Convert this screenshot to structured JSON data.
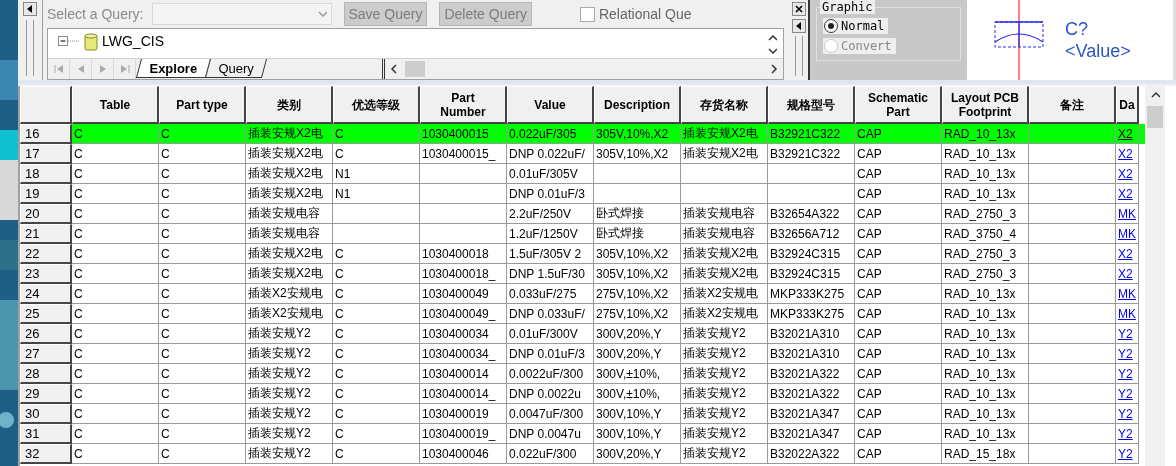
{
  "query_bar": {
    "label": "Select a Query:",
    "buttons": [
      {
        "label": "Save Query",
        "disabled": true
      },
      {
        "label": "Delete Query",
        "disabled": true
      }
    ],
    "relational": {
      "label": "Relational Que",
      "checked": false
    }
  },
  "explorer": {
    "tree": [
      {
        "label": "LWG_CIS",
        "expanded": true
      }
    ],
    "tabs": [
      {
        "label": "Explore",
        "selected": true
      },
      {
        "label": "Query",
        "selected": false
      }
    ]
  },
  "preview": {
    "group": "Graphic",
    "options": [
      {
        "label": "Normal",
        "selected": true,
        "disabled": false
      },
      {
        "label": "Convert",
        "selected": false,
        "disabled": true
      }
    ],
    "refdes": "C?",
    "value": "<Value>"
  },
  "table": {
    "columns": [
      {
        "label": "Table",
        "kind": "text"
      },
      {
        "label": "Part type",
        "kind": "text"
      },
      {
        "label": "类别",
        "kind": "text"
      },
      {
        "label": "优选等级",
        "kind": "text"
      },
      {
        "label": "Part Number",
        "kind": "text"
      },
      {
        "label": "Value",
        "kind": "text"
      },
      {
        "label": "Description",
        "kind": "text"
      },
      {
        "label": "存货名称",
        "kind": "text"
      },
      {
        "label": "规格型号",
        "kind": "text"
      },
      {
        "label": "Schematic Part",
        "kind": "text"
      },
      {
        "label": "Layout PCB Footprint",
        "kind": "text"
      },
      {
        "label": "备注",
        "kind": "text"
      },
      {
        "label": "Da",
        "kind": "link"
      }
    ],
    "rows": [
      {
        "num": "16",
        "selected": true,
        "cells": [
          "C",
          "C",
          "插装安规X2电",
          "C",
          "1030400015",
          "0.022uF/305",
          "305V,10%,X2",
          "插装安规X2电",
          "B32921C322",
          "CAP",
          "RAD_10_13x",
          null,
          "X2"
        ]
      },
      {
        "num": "17",
        "selected": false,
        "cells": [
          "C",
          "C",
          "插装安规X2电",
          "C",
          "1030400015_",
          "DNP 0.022uF/",
          "305V,10%,X2",
          "插装安规X2电",
          "B32921C322",
          "CAP",
          "RAD_10_13x",
          null,
          "X2"
        ]
      },
      {
        "num": "18",
        "selected": false,
        "cells": [
          "C",
          "C",
          "插装安规X2电",
          "N1",
          null,
          "0.01uF/305V",
          null,
          null,
          null,
          "CAP",
          "RAD_10_13x",
          null,
          "X2"
        ]
      },
      {
        "num": "19",
        "selected": false,
        "cells": [
          "C",
          "C",
          "插装安规X2电",
          "N1",
          null,
          "DNP 0.01uF/3",
          null,
          null,
          null,
          "CAP",
          "RAD_10_13x",
          null,
          "X2"
        ]
      },
      {
        "num": "20",
        "selected": false,
        "cells": [
          "C",
          "C",
          "插装安规电容",
          null,
          null,
          "2.2uF/250V",
          "卧式焊接",
          "插装安规电容",
          "B32654A322",
          "CAP",
          "RAD_2750_3",
          null,
          "MK"
        ]
      },
      {
        "num": "21",
        "selected": false,
        "cells": [
          "C",
          "C",
          "插装安规电容",
          null,
          null,
          "1.2uF/1250V",
          "卧式焊接",
          "插装安规电容",
          "B32656A712",
          "CAP",
          "RAD_3750_4",
          null,
          "MK"
        ]
      },
      {
        "num": "22",
        "selected": false,
        "cells": [
          "C",
          "C",
          "插装安规X2电",
          "C",
          "1030400018",
          "1.5uF/305V 2",
          "305V,10%,X2",
          "插装安规X2电",
          "B32924C315",
          "CAP",
          "RAD_2750_3",
          null,
          "X2"
        ]
      },
      {
        "num": "23",
        "selected": false,
        "cells": [
          "C",
          "C",
          "插装安规X2电",
          "C",
          "1030400018_",
          "DNP 1.5uF/30",
          "305V,10%,X2",
          "插装安规X2电",
          "B32924C315",
          "CAP",
          "RAD_2750_3",
          null,
          "X2"
        ]
      },
      {
        "num": "24",
        "selected": false,
        "cells": [
          "C",
          "C",
          "插装X2安规电",
          "C",
          "1030400049",
          "0.033uF/275",
          "275V,10%,X2",
          "插装X2安规电",
          "MKP333K275",
          "CAP",
          "RAD_10_13x",
          null,
          "MK"
        ]
      },
      {
        "num": "25",
        "selected": false,
        "cells": [
          "C",
          "C",
          "插装X2安规电",
          "C",
          "1030400049_",
          "DNP 0.033uF/",
          "275V,10%,X2",
          "插装X2安规电",
          "MKP333K275",
          "CAP",
          "RAD_10_13x",
          null,
          "MK"
        ]
      },
      {
        "num": "26",
        "selected": false,
        "cells": [
          "C",
          "C",
          "插装安规Y2",
          "C",
          "1030400034",
          "0.01uF/300V",
          "300V,20%,Y",
          "插装安规Y2",
          "B32021A310",
          "CAP",
          "RAD_10_13x",
          null,
          "Y2"
        ]
      },
      {
        "num": "27",
        "selected": false,
        "cells": [
          "C",
          "C",
          "插装安规Y2",
          "C",
          "1030400034_",
          "DNP 0.01uF/3",
          "300V,20%,Y",
          "插装安规Y2",
          "B32021A310",
          "CAP",
          "RAD_10_13x",
          null,
          "Y2"
        ]
      },
      {
        "num": "28",
        "selected": false,
        "cells": [
          "C",
          "C",
          "插装安规Y2",
          "C",
          "1030400014",
          "0.0022uF/300",
          "300V,±10%,",
          "插装安规Y2",
          "B32021A322",
          "CAP",
          "RAD_10_13x",
          null,
          "Y2"
        ]
      },
      {
        "num": "29",
        "selected": false,
        "cells": [
          "C",
          "C",
          "插装安规Y2",
          "C",
          "1030400014_",
          "DNP 0.0022u",
          "300V,±10%,",
          "插装安规Y2",
          "B32021A322",
          "CAP",
          "RAD_10_13x",
          null,
          "Y2"
        ]
      },
      {
        "num": "30",
        "selected": false,
        "cells": [
          "C",
          "C",
          "插装安规Y2",
          "C",
          "1030400019",
          "0.0047uF/300",
          "300V,10%,Y",
          "插装安规Y2",
          "B32021A347",
          "CAP",
          "RAD_10_13x",
          null,
          "Y2"
        ]
      },
      {
        "num": "31",
        "selected": false,
        "cells": [
          "C",
          "C",
          "插装安规Y2",
          "C",
          "1030400019_",
          "DNP 0.0047u",
          "300V,10%,Y",
          "插装安规Y2",
          "B32021A347",
          "CAP",
          "RAD_10_13x",
          null,
          "Y2"
        ]
      },
      {
        "num": "32",
        "selected": false,
        "cells": [
          "C",
          "C",
          "插装安规Y2",
          "C",
          "1030400046",
          "0.022uF/300",
          "300V,20%,Y",
          "插装安规Y2",
          "B32022A322",
          "CAP",
          "RAD_15_18x",
          null,
          "Y2"
        ]
      }
    ]
  }
}
